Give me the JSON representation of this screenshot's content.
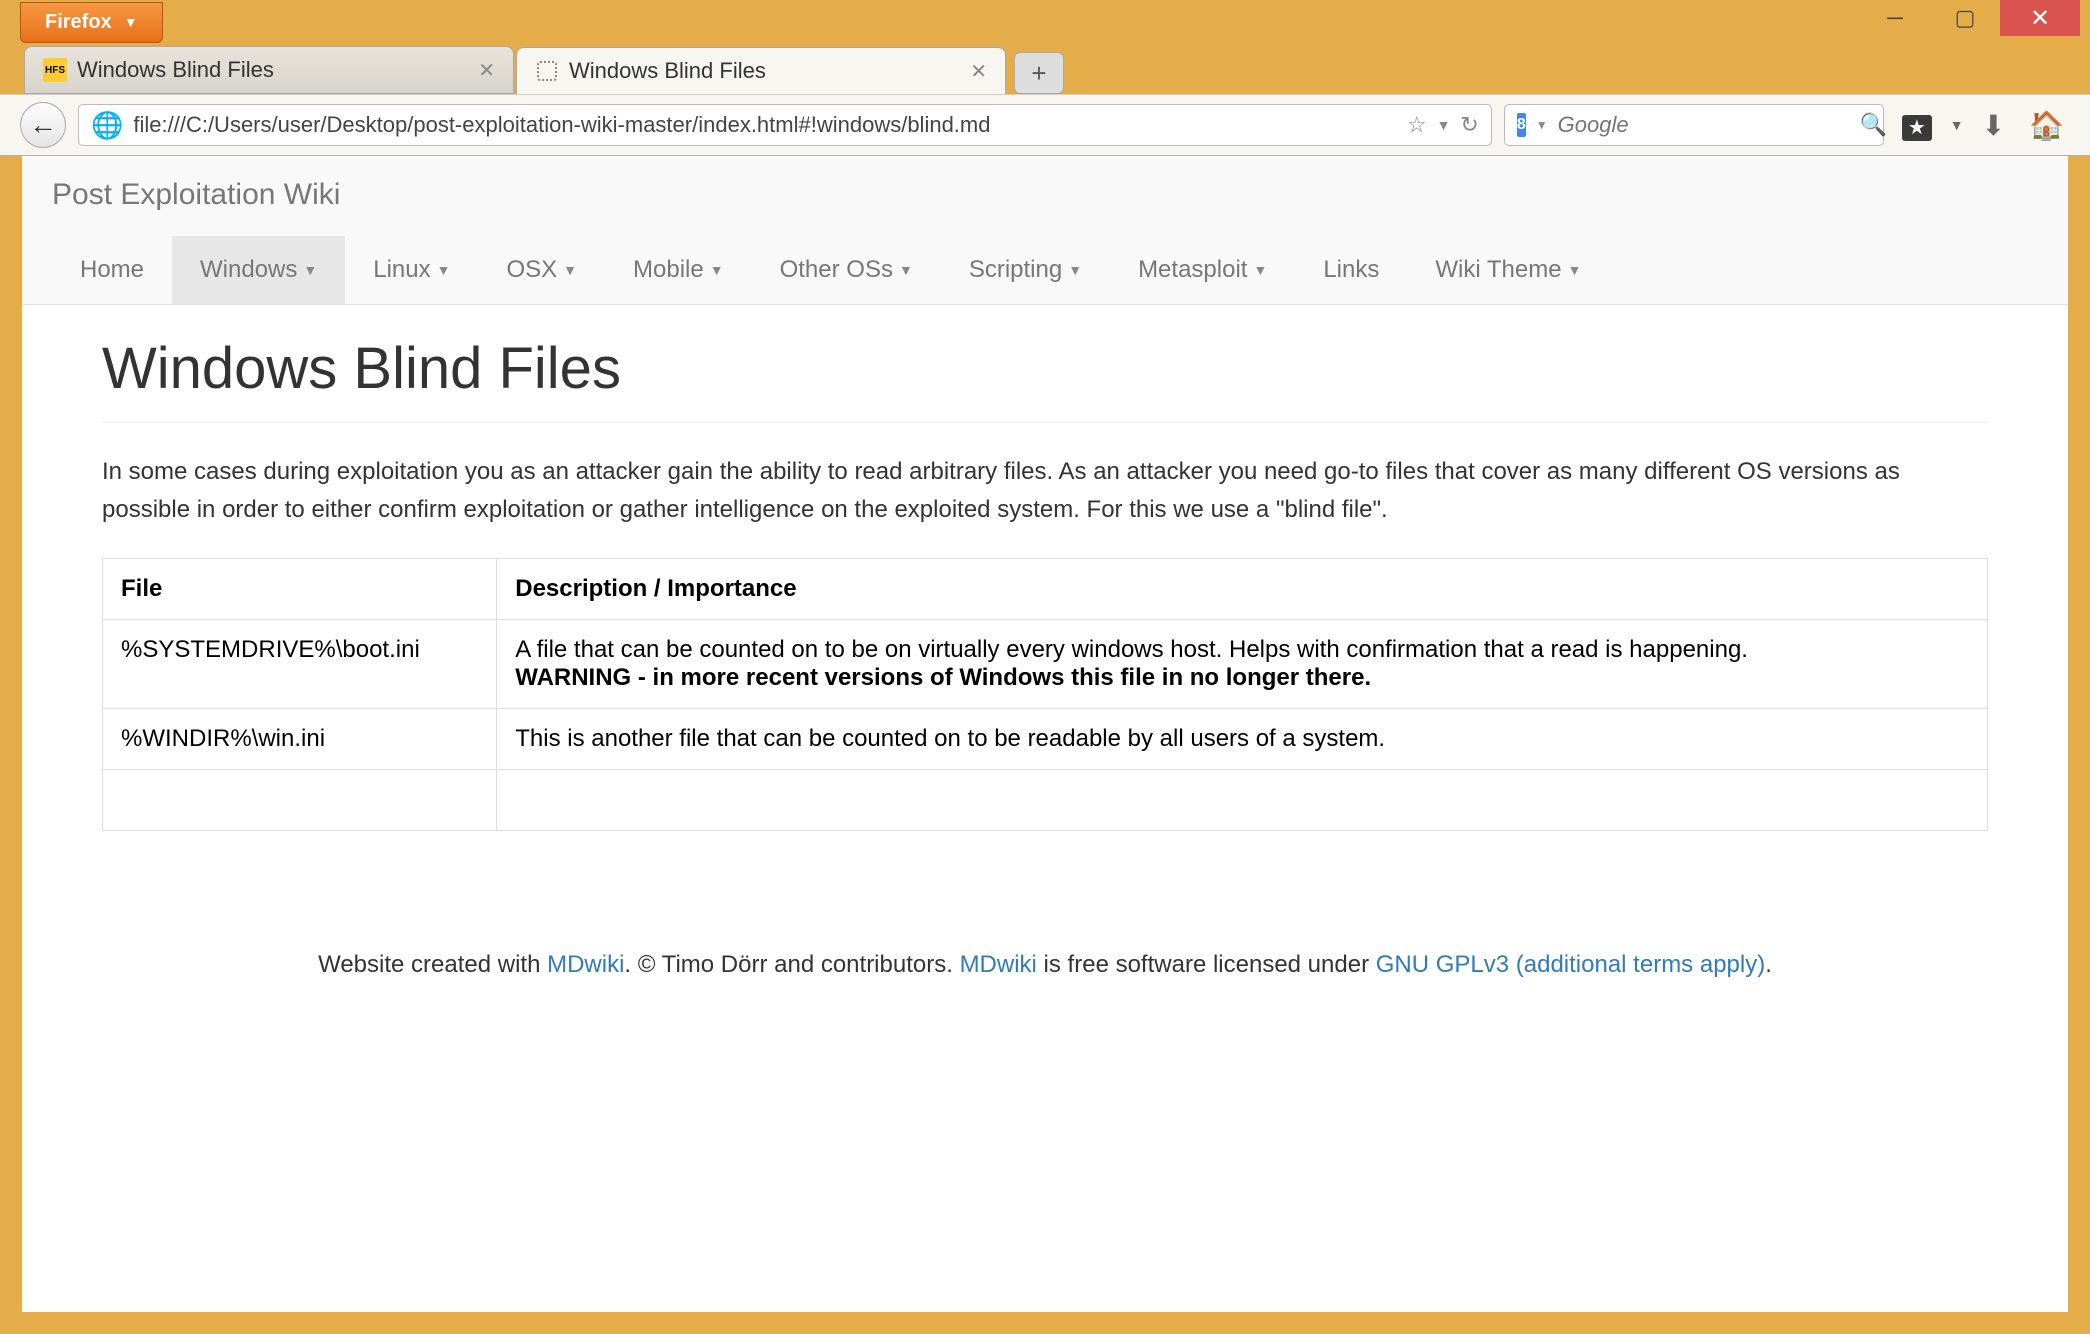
{
  "firefox_label": "Firefox",
  "tabs": [
    {
      "title": "Windows Blind Files",
      "active": false
    },
    {
      "title": "Windows Blind Files",
      "active": true
    }
  ],
  "url": "file:///C:/Users/user/Desktop/post-exploitation-wiki-master/index.html#!windows/blind.md",
  "search_placeholder": "Google",
  "site_title": "Post Exploitation Wiki",
  "nav": [
    {
      "label": "Home",
      "dropdown": false,
      "active": false
    },
    {
      "label": "Windows",
      "dropdown": true,
      "active": true
    },
    {
      "label": "Linux",
      "dropdown": true,
      "active": false
    },
    {
      "label": "OSX",
      "dropdown": true,
      "active": false
    },
    {
      "label": "Mobile",
      "dropdown": true,
      "active": false
    },
    {
      "label": "Other OSs",
      "dropdown": true,
      "active": false
    },
    {
      "label": "Scripting",
      "dropdown": true,
      "active": false
    },
    {
      "label": "Metasploit",
      "dropdown": true,
      "active": false
    },
    {
      "label": "Links",
      "dropdown": false,
      "active": false
    },
    {
      "label": "Wiki Theme",
      "dropdown": true,
      "active": false
    }
  ],
  "page_heading": "Windows Blind Files",
  "intro_text": "In some cases during exploitation you as an attacker gain the ability to read arbitrary files. As an attacker you need go-to files that cover as many different OS versions as possible in order to either confirm exploitation or gather intelligence on the exploited system. For this we use a \"blind file\".",
  "table": {
    "headers": [
      "File",
      "Description / Importance"
    ],
    "rows": [
      {
        "file": "%SYSTEMDRIVE%\\boot.ini",
        "desc": "A file that can be counted on to be on virtually every windows host. Helps with confirmation that a read is happening.",
        "warning": "WARNING - in more recent versions of Windows this file in no longer there."
      },
      {
        "file": "%WINDIR%\\win.ini",
        "desc": "This is another file that can be counted on to be readable by all users of a system.",
        "warning": ""
      },
      {
        "file": "",
        "desc": "",
        "warning": ""
      }
    ]
  },
  "footer": {
    "pre1": "Website created with ",
    "link1": "MDwiki",
    "mid1": ". © Timo Dörr and contributors. ",
    "link2": "MDwiki",
    "mid2": " is free software licensed under ",
    "link3": "GNU GPLv3 (additional terms apply)",
    "post": "."
  }
}
